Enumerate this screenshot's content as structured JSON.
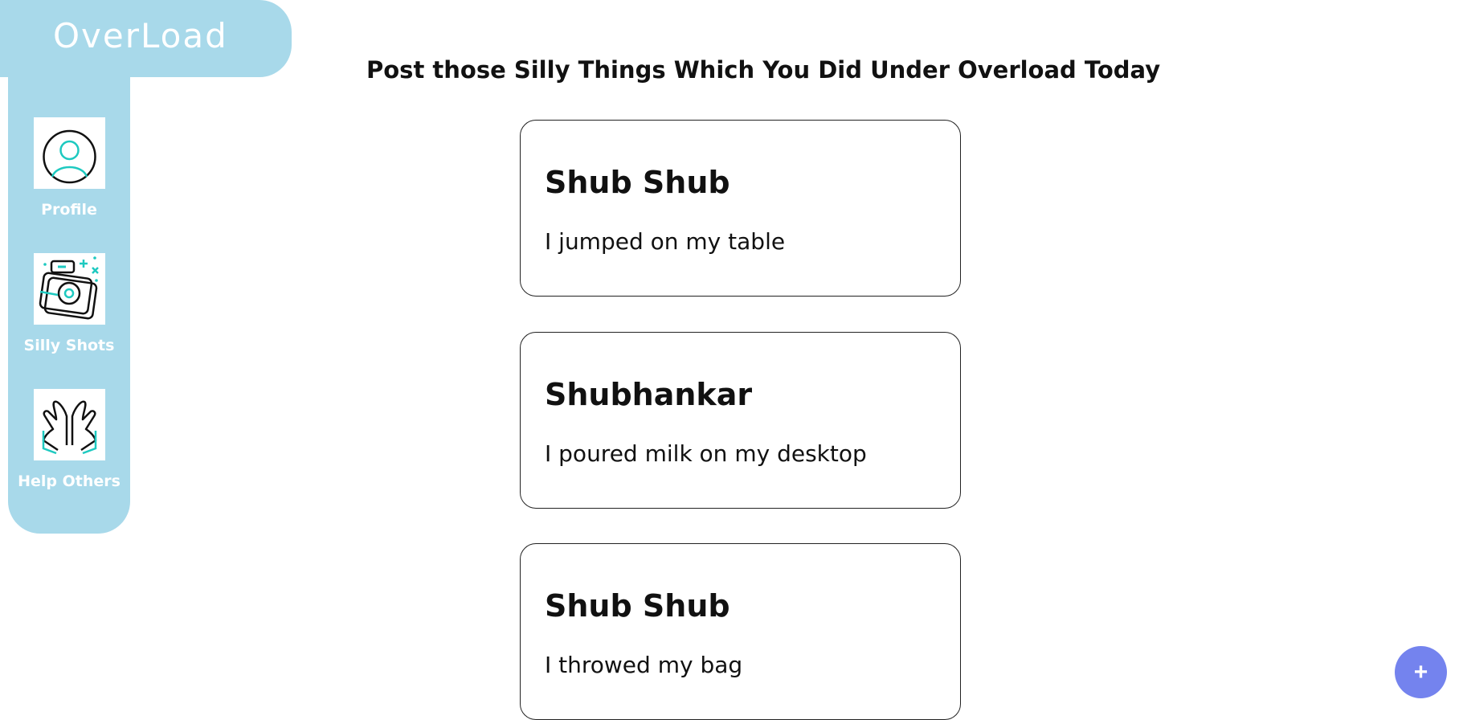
{
  "app": {
    "logo_text": "OverLoad"
  },
  "sidebar": {
    "items": [
      {
        "label": "Profile",
        "icon": "profile-icon"
      },
      {
        "label": "Silly Shots",
        "icon": "camera-icon"
      },
      {
        "label": "Help Others",
        "icon": "praying-hands-icon"
      }
    ]
  },
  "main": {
    "heading": "Post those Silly Things Which You Did Under Overload Today",
    "posts": [
      {
        "author": "Shub Shub",
        "text": "I jumped on my table"
      },
      {
        "author": "Shubhankar",
        "text": "I poured milk on my desktop"
      },
      {
        "author": "Shub Shub",
        "text": "I throwed my bag"
      }
    ]
  },
  "fab": {
    "label": "+",
    "icon": "plus-icon"
  },
  "colors": {
    "sidebar_bg": "#a8d9ea",
    "fab_bg": "#7483ee",
    "icon_accent": "#1ec9c0"
  }
}
